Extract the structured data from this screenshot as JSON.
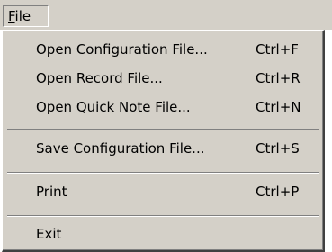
{
  "menubar": {
    "title_mnemonic": "F",
    "title_rest": "ile"
  },
  "menu": {
    "items": [
      {
        "label": "Open Configuration File...",
        "shortcut": "Ctrl+F"
      },
      {
        "label": "Open Record File...",
        "shortcut": "Ctrl+R"
      },
      {
        "label": "Open Quick Note File...",
        "shortcut": "Ctrl+N"
      },
      {
        "label": "Save Configuration File...",
        "shortcut": "Ctrl+S"
      },
      {
        "label": "Print",
        "shortcut": "Ctrl+P"
      },
      {
        "label": "Exit",
        "shortcut": ""
      }
    ]
  },
  "colors": {
    "menu_background": "#d4d0c8",
    "shadow": "#808080",
    "highlight": "#ffffff"
  }
}
